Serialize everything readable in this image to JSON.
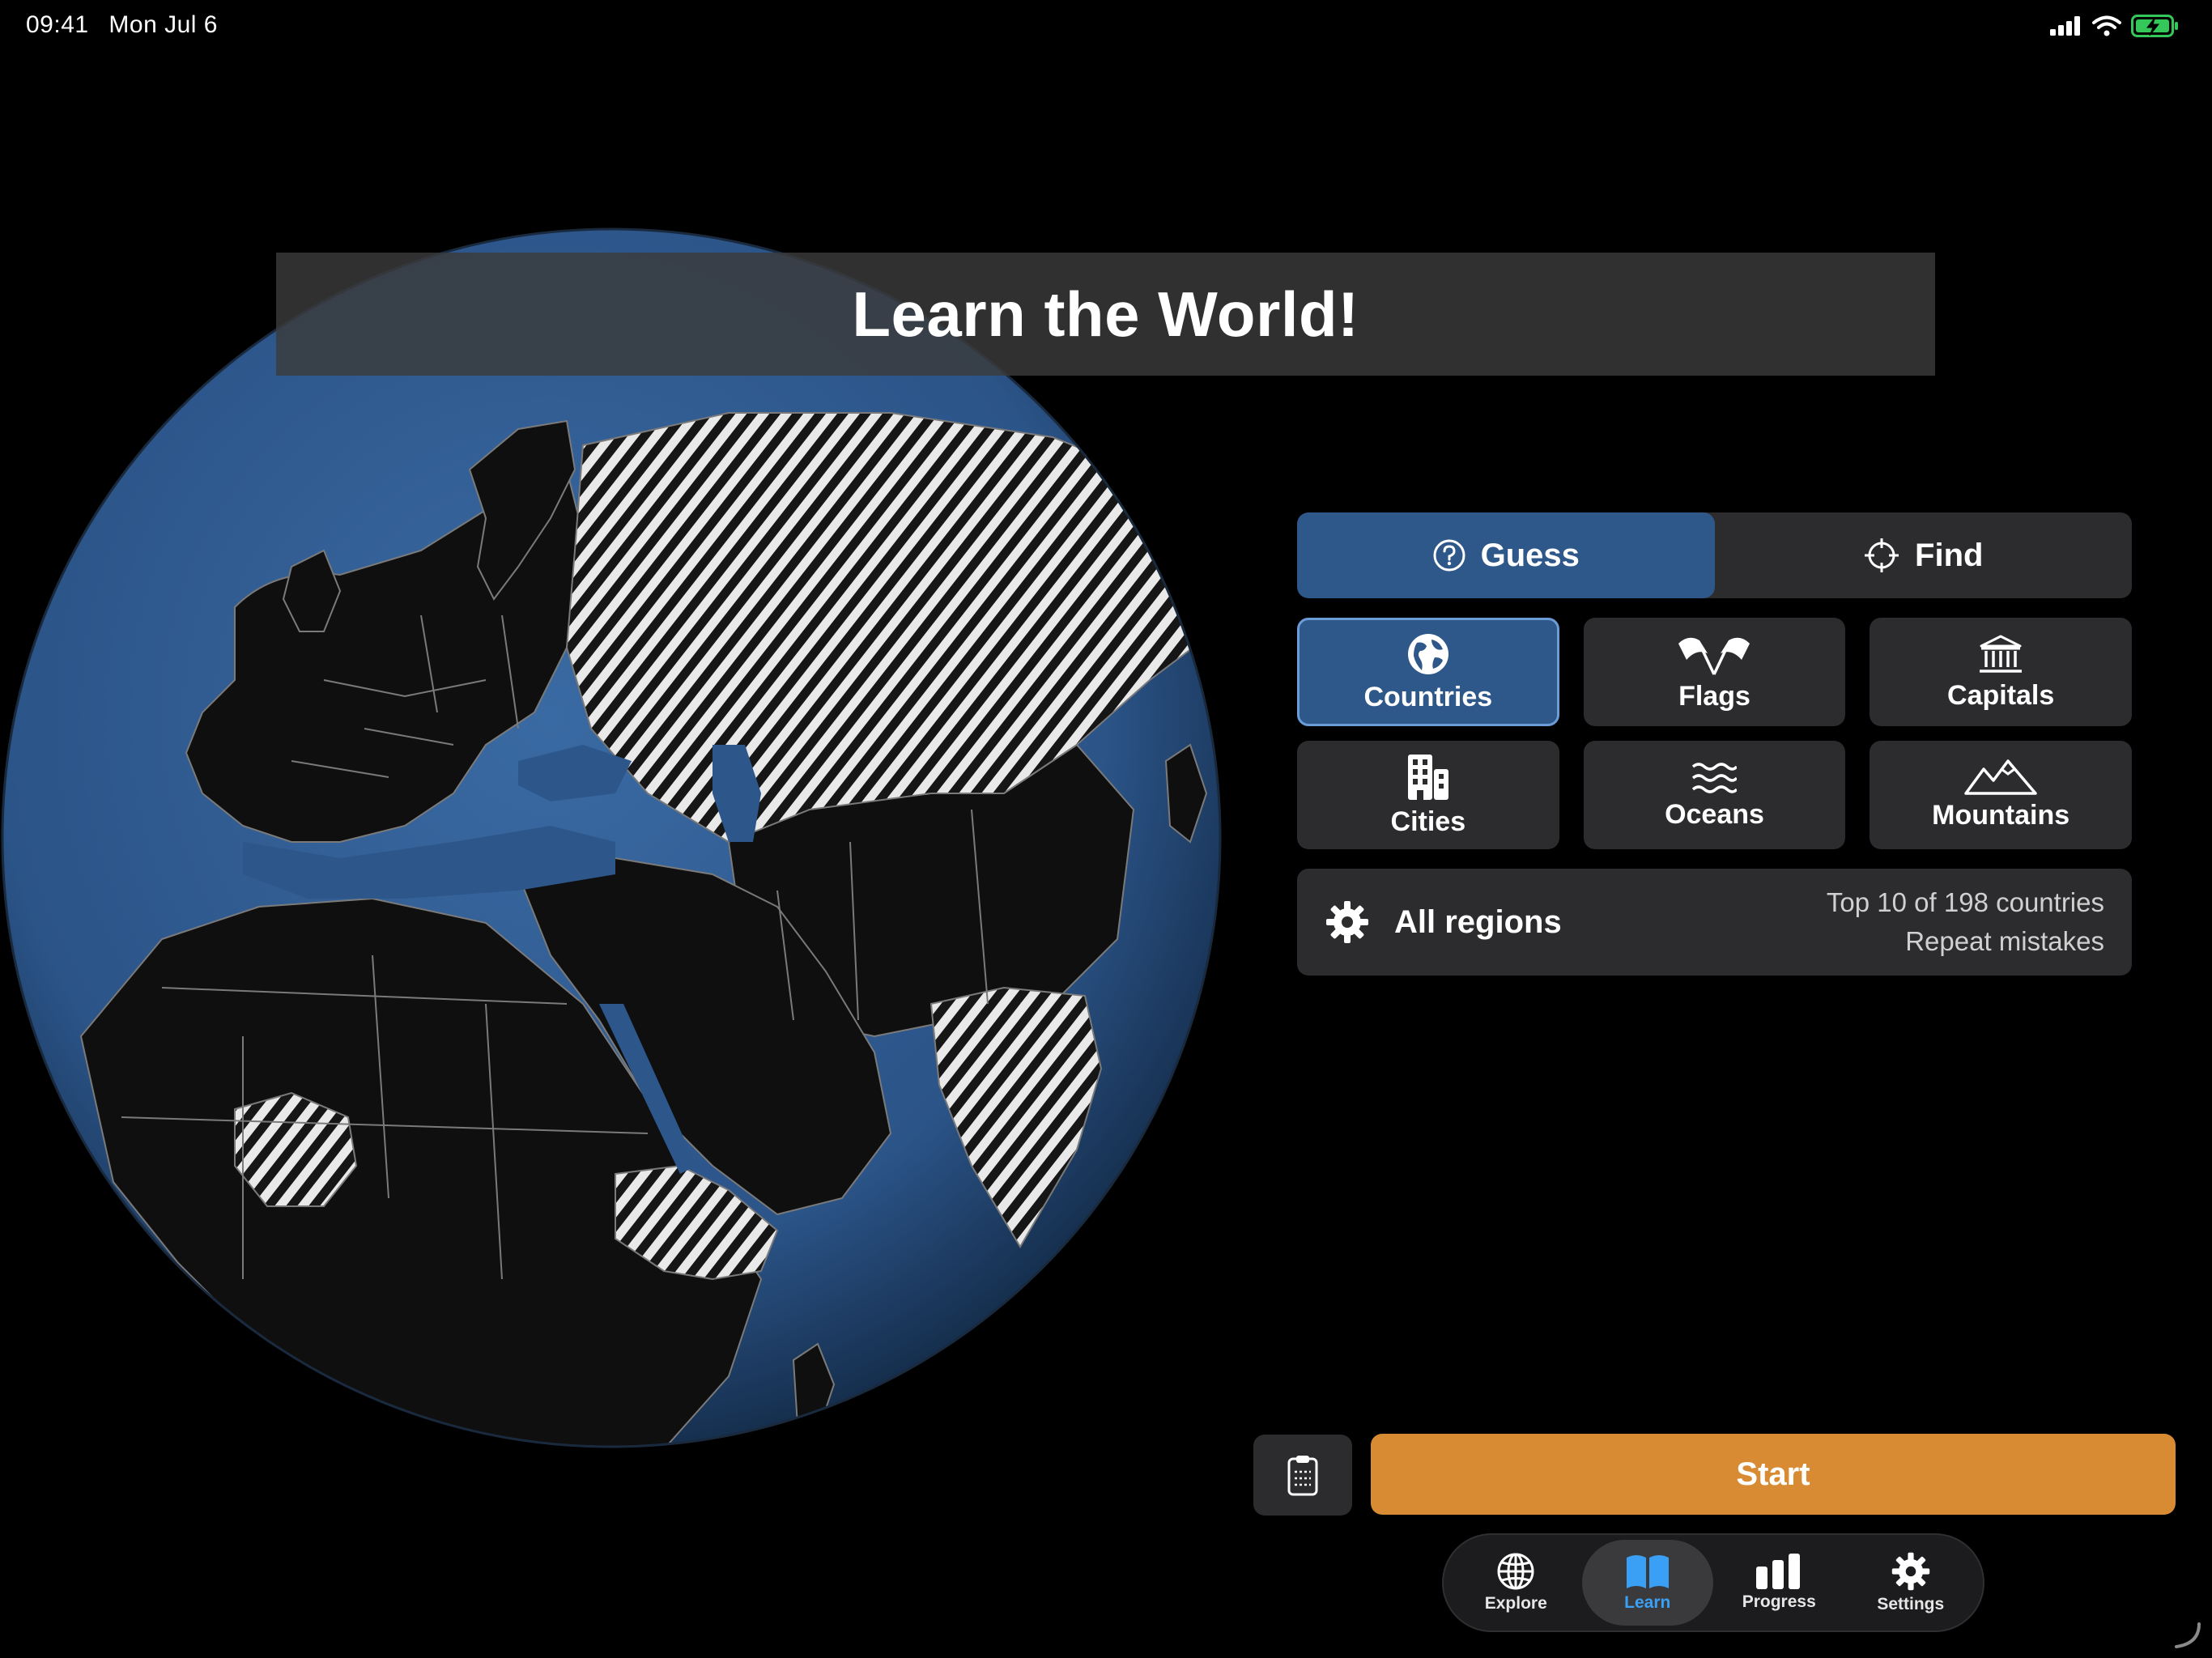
{
  "status_bar": {
    "time": "09:41",
    "date": "Mon Jul 6"
  },
  "title": "Learn the World!",
  "mode": {
    "options": [
      {
        "label": "Guess",
        "icon": "question-circle-icon",
        "active": true
      },
      {
        "label": "Find",
        "icon": "crosshair-icon",
        "active": false
      }
    ]
  },
  "categories": [
    {
      "label": "Countries",
      "icon": "globe-icon",
      "active": true
    },
    {
      "label": "Flags",
      "icon": "flags-icon",
      "active": false
    },
    {
      "label": "Capitals",
      "icon": "building-columns-icon",
      "active": false
    },
    {
      "label": "Cities",
      "icon": "city-building-icon",
      "active": false
    },
    {
      "label": "Oceans",
      "icon": "waves-icon",
      "active": false
    },
    {
      "label": "Mountains",
      "icon": "mountains-icon",
      "active": false
    }
  ],
  "regions": {
    "label": "All regions",
    "info_line1": "Top 10 of 198 countries",
    "info_line2": "Repeat mistakes"
  },
  "start_label": "Start",
  "tabs": [
    {
      "label": "Explore",
      "icon": "globe-grid-icon",
      "active": false
    },
    {
      "label": "Learn",
      "icon": "book-icon",
      "active": true
    },
    {
      "label": "Progress",
      "icon": "bar-chart-icon",
      "active": false
    },
    {
      "label": "Settings",
      "icon": "gear-icon",
      "active": false
    }
  ],
  "colors": {
    "accent_blue": "#2e578a",
    "start_orange": "#d88b33",
    "active_tab_blue": "#3aa0f5",
    "button_bg": "#2c2c2e",
    "ocean": "#2f5a8f",
    "battery_green": "#34c759"
  }
}
